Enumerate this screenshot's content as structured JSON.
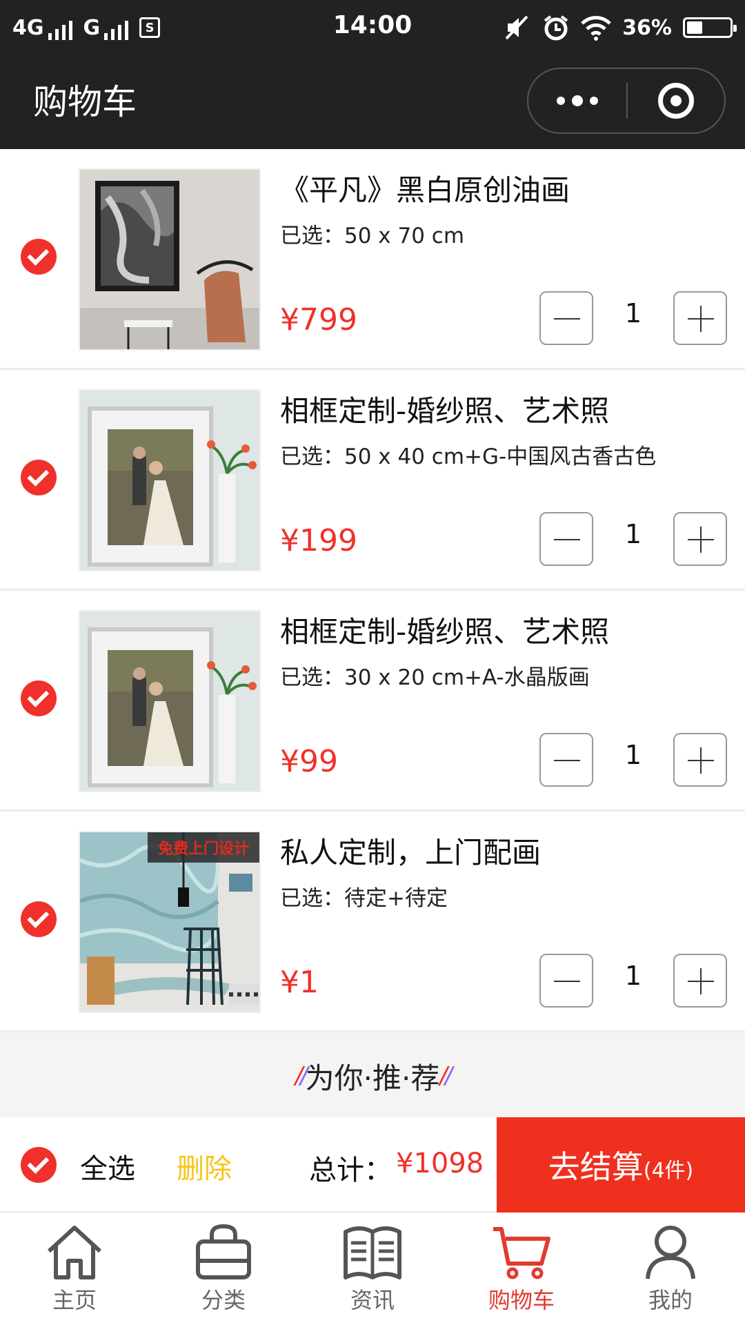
{
  "status_bar": {
    "network1": "4G",
    "network2": "G",
    "sim_badge": "S",
    "time": "14:00",
    "battery_text": "36%",
    "battery_level": 0.36
  },
  "nav": {
    "title": "购物车"
  },
  "colors": {
    "accent_red": "#f0302a",
    "pay_button": "#f0301f",
    "delete_yellow": "#f5c518",
    "dark_bar": "#222222"
  },
  "cart": {
    "spec_prefix": "已选：",
    "items": [
      {
        "title": "《平凡》黑白原创油画",
        "spec": "50 x 70 cm",
        "price": "¥799",
        "qty": "1",
        "checked": true
      },
      {
        "title": "相框定制-婚纱照、艺术照",
        "spec": "50 x 40 cm+G-中国风古香古色",
        "price": "¥199",
        "qty": "1",
        "checked": true
      },
      {
        "title": "相框定制-婚纱照、艺术照",
        "spec": "30 x 20 cm+A-水晶版画",
        "price": "¥99",
        "qty": "1",
        "checked": true
      },
      {
        "title": "私人定制，上门配画",
        "spec": "待定+待定",
        "price": "¥1",
        "qty": "1",
        "checked": true,
        "thumb_badge": "免费上门设计"
      }
    ]
  },
  "recommend": {
    "label": "为你·推·荐"
  },
  "checkout": {
    "select_all": "全选",
    "delete": "删除",
    "total_label": "总计：",
    "total_value": "¥1098",
    "pay_label": "去结算",
    "pay_count": "(4件)"
  },
  "tabs": [
    {
      "label": "主页",
      "icon": "home-icon",
      "active": false
    },
    {
      "label": "分类",
      "icon": "bag-icon",
      "active": false
    },
    {
      "label": "资讯",
      "icon": "news-icon",
      "active": false
    },
    {
      "label": "购物车",
      "icon": "cart-icon",
      "active": true
    },
    {
      "label": "我的",
      "icon": "user-icon",
      "active": false
    }
  ]
}
